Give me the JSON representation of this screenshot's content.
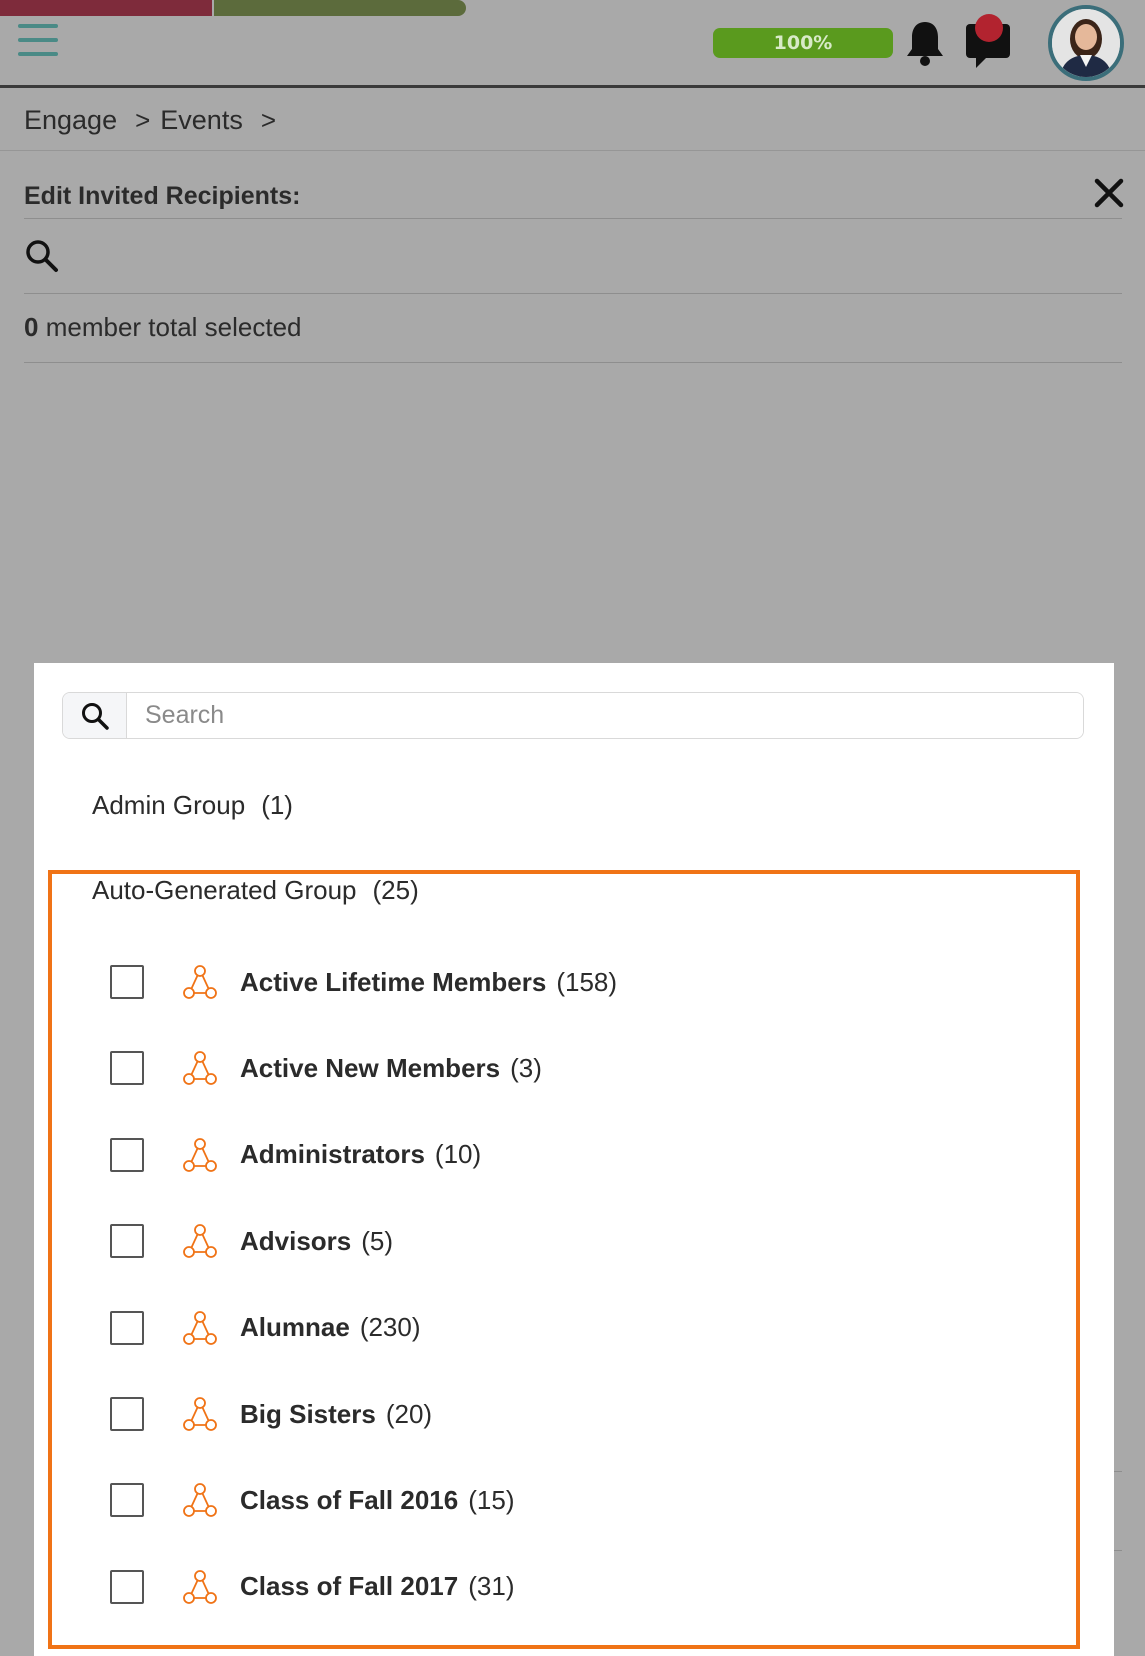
{
  "topbar": {
    "battery_label": "100%",
    "colors": {
      "accent": "#4a8a86",
      "battery": "#5a9a1e",
      "red_bar": "#7e2b3b",
      "green_bar": "#5c6b3c"
    }
  },
  "breadcrumb": {
    "items": [
      "Engage",
      "Events"
    ],
    "separator": ">"
  },
  "editor": {
    "title": "Edit Invited Recipients:",
    "selected_count": "0",
    "selected_label": "member total selected"
  },
  "dropdown": {
    "search_placeholder": "Search",
    "groups": [
      {
        "name": "Admin Group",
        "count": "(1)"
      },
      {
        "name": "Auto-Generated Group",
        "count": "(25)"
      }
    ],
    "items": [
      {
        "name": "Active Lifetime Members",
        "count": "(158)",
        "checked": false
      },
      {
        "name": "Active New Members",
        "count": "(3)",
        "checked": false
      },
      {
        "name": "Administrators",
        "count": "(10)",
        "checked": false
      },
      {
        "name": "Advisors",
        "count": "(5)",
        "checked": false
      },
      {
        "name": "Alumnae",
        "count": "(230)",
        "checked": false
      },
      {
        "name": "Big Sisters",
        "count": "(20)",
        "checked": false
      },
      {
        "name": "Class of Fall 2016",
        "count": "(15)",
        "checked": false
      },
      {
        "name": "Class of Fall 2017",
        "count": "(31)",
        "checked": false
      }
    ],
    "highlight_color": "#f07316",
    "group_icon_color": "#f07316"
  }
}
